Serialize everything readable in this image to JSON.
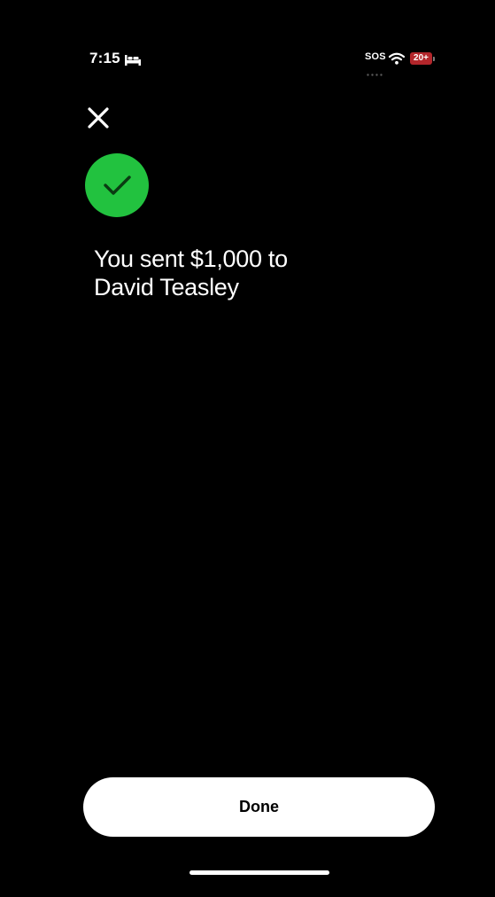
{
  "status_bar": {
    "time": "7:15",
    "sleep_icon": "bed-icon",
    "sos": "SOS",
    "wifi_icon": "wifi-icon",
    "battery": "20+"
  },
  "header": {
    "close_icon": "close-icon"
  },
  "confirmation": {
    "icon": "checkmark-icon",
    "icon_color": "#22c23f",
    "message_line1": "You sent $1,000 to",
    "message_line2": "David Teasley"
  },
  "footer": {
    "done_label": "Done"
  },
  "colors": {
    "background": "#000000",
    "accent_green": "#22c23f",
    "battery_low_red": "#b3262b",
    "button_bg": "#ffffff",
    "button_text": "#000000"
  }
}
